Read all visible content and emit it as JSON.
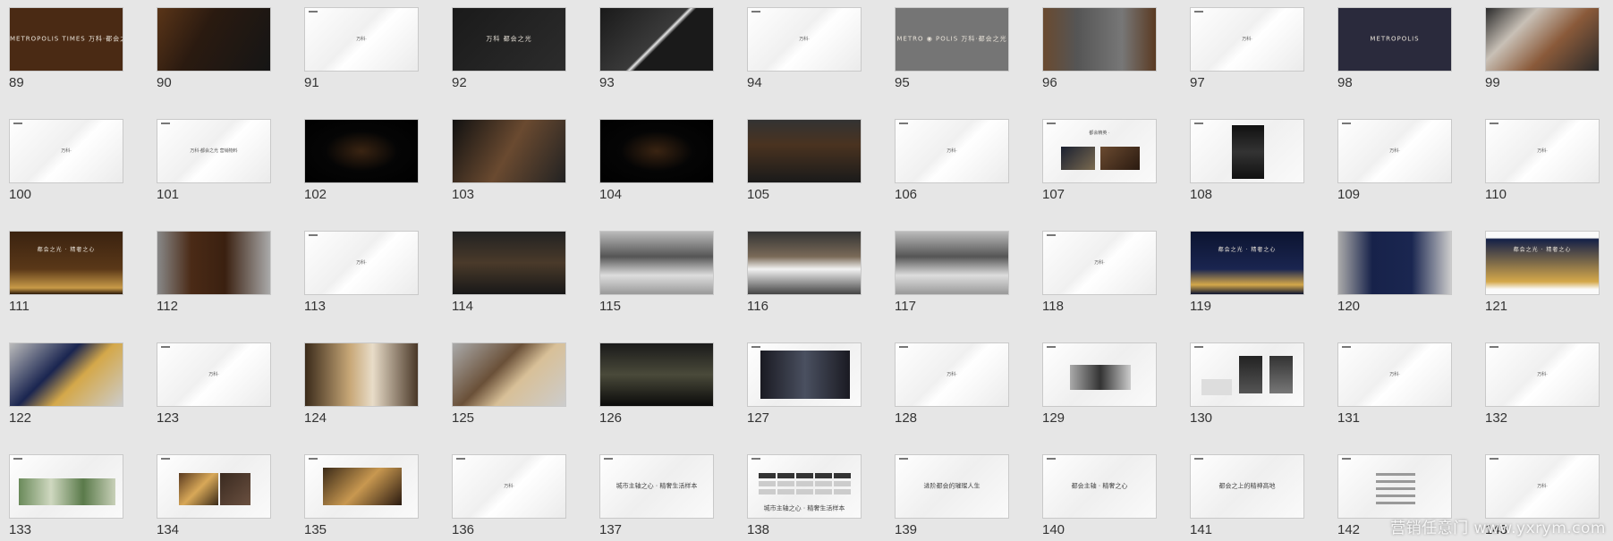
{
  "slides": [
    {
      "n": "89",
      "style": "brown-logo",
      "caption": "METROPOLIS TIMES 万科·都会之光"
    },
    {
      "n": "90",
      "style": "dark-book",
      "caption": ""
    },
    {
      "n": "91",
      "style": "light",
      "caption": "万科·"
    },
    {
      "n": "92",
      "style": "black-logo",
      "caption": "万科 都会之光"
    },
    {
      "n": "93",
      "style": "card",
      "caption": ""
    },
    {
      "n": "94",
      "style": "light",
      "caption": "万科·"
    },
    {
      "n": "95",
      "style": "gray-logo",
      "caption": "METRO ◉ POLIS 万科·都会之光"
    },
    {
      "n": "96",
      "style": "pen",
      "caption": ""
    },
    {
      "n": "97",
      "style": "light",
      "caption": "万科·"
    },
    {
      "n": "98",
      "style": "navy-logo",
      "caption": "METROPOLIS"
    },
    {
      "n": "99",
      "style": "umbrella",
      "caption": ""
    },
    {
      "n": "100",
      "style": "light",
      "caption": "万科·"
    },
    {
      "n": "101",
      "style": "light",
      "caption": "万科·都会之光 营销物料"
    },
    {
      "n": "102",
      "style": "phone-dark",
      "caption": ""
    },
    {
      "n": "103",
      "style": "phone",
      "caption": ""
    },
    {
      "n": "104",
      "style": "phone-dark",
      "caption": ""
    },
    {
      "n": "105",
      "style": "billboard",
      "caption": ""
    },
    {
      "n": "106",
      "style": "light",
      "caption": "万科·"
    },
    {
      "n": "107",
      "style": "light-photos",
      "caption": "都会精英 ·"
    },
    {
      "n": "108",
      "style": "light-phone",
      "caption": ""
    },
    {
      "n": "109",
      "style": "light",
      "caption": "万科·"
    },
    {
      "n": "110",
      "style": "light",
      "caption": "万科·"
    },
    {
      "n": "111",
      "style": "brown-skyline",
      "caption": "都会之光 · 精奢之心"
    },
    {
      "n": "112",
      "style": "subway",
      "caption": ""
    },
    {
      "n": "113",
      "style": "light",
      "caption": "万科·"
    },
    {
      "n": "114",
      "style": "dark-banner",
      "caption": ""
    },
    {
      "n": "115",
      "style": "bus-stop",
      "caption": ""
    },
    {
      "n": "116",
      "style": "dark-banner-light",
      "caption": ""
    },
    {
      "n": "117",
      "style": "bus-stop",
      "caption": ""
    },
    {
      "n": "118",
      "style": "light",
      "caption": "万科·"
    },
    {
      "n": "119",
      "style": "navy-skyline",
      "caption": "都会之光 · 精奢之心"
    },
    {
      "n": "120",
      "style": "subway-navy",
      "caption": ""
    },
    {
      "n": "121",
      "style": "navy-skyline-frame",
      "caption": "都会之光 · 精奢之心"
    },
    {
      "n": "122",
      "style": "newspaper",
      "caption": ""
    },
    {
      "n": "123",
      "style": "light",
      "caption": "万科·"
    },
    {
      "n": "124",
      "style": "gold-smoke",
      "caption": ""
    },
    {
      "n": "125",
      "style": "newspaper-gold",
      "caption": ""
    },
    {
      "n": "126",
      "style": "metro-wall",
      "caption": ""
    },
    {
      "n": "127",
      "style": "light-photo-dark",
      "caption": ""
    },
    {
      "n": "128",
      "style": "light",
      "caption": "万科·"
    },
    {
      "n": "129",
      "style": "light-portrait",
      "caption": ""
    },
    {
      "n": "130",
      "style": "light-portraits",
      "caption": ""
    },
    {
      "n": "131",
      "style": "light",
      "caption": "万科·"
    },
    {
      "n": "132",
      "style": "light",
      "caption": "万科·"
    },
    {
      "n": "133",
      "style": "light-trees",
      "caption": ""
    },
    {
      "n": "134",
      "style": "light-interior",
      "caption": ""
    },
    {
      "n": "135",
      "style": "light-interior2",
      "caption": ""
    },
    {
      "n": "136",
      "style": "light",
      "caption": "万科·"
    },
    {
      "n": "137",
      "style": "light-text",
      "caption": "城市主轴之心 · 精奢生活样本"
    },
    {
      "n": "138",
      "style": "light-table",
      "caption": "城市主轴之心 · 精奢生活样本"
    },
    {
      "n": "139",
      "style": "light-text",
      "caption": "进阶都会的璀璨人生"
    },
    {
      "n": "140",
      "style": "light-text",
      "caption": "都会主轴 · 精奢之心"
    },
    {
      "n": "141",
      "style": "light-text",
      "caption": "都会之上的精神高地"
    },
    {
      "n": "142",
      "style": "light-list",
      "caption": ""
    },
    {
      "n": "143",
      "style": "light",
      "caption": "万科·"
    }
  ],
  "watermark": "营销任意门 www.yxrym.com",
  "colors": {
    "background": "#e6e6e6",
    "number_text": "#333333"
  }
}
